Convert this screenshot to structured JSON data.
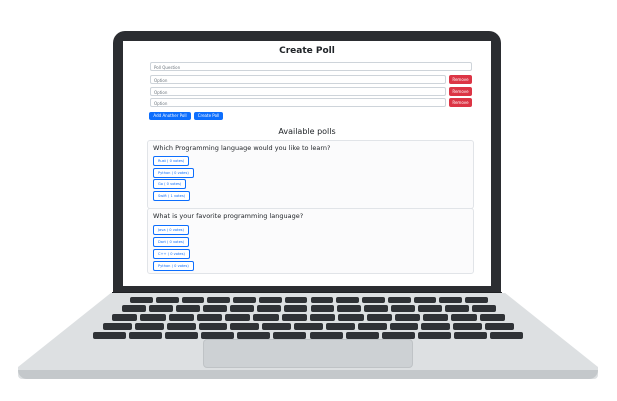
{
  "create_poll": {
    "title": "Create Poll",
    "question_placeholder": "Poll Question",
    "options": [
      {
        "placeholder": "Option",
        "remove_label": "Remove"
      },
      {
        "placeholder": "Option",
        "remove_label": "Remove"
      },
      {
        "placeholder": "Option",
        "remove_label": "Remove"
      }
    ],
    "add_label": "Add Another Poll",
    "create_label": "Create Poll"
  },
  "available": {
    "title": "Available polls",
    "polls": [
      {
        "question": "Which Programming language would you like to learn?",
        "options": [
          "Rust ( 0 votes)",
          "Python ( 0 votes)",
          "Go ( 0 votes)",
          "Swift ( 1 votes)"
        ]
      },
      {
        "question": "What is your favorite programming language?",
        "options": [
          "Java ( 0 votes)",
          "Dart ( 0 votes)",
          "C++ ( 0 votes)",
          "Python ( 0 votes)"
        ]
      }
    ]
  },
  "colors": {
    "primary": "#0d6efd",
    "danger": "#dc3545",
    "bezel": "#2b2d31"
  }
}
